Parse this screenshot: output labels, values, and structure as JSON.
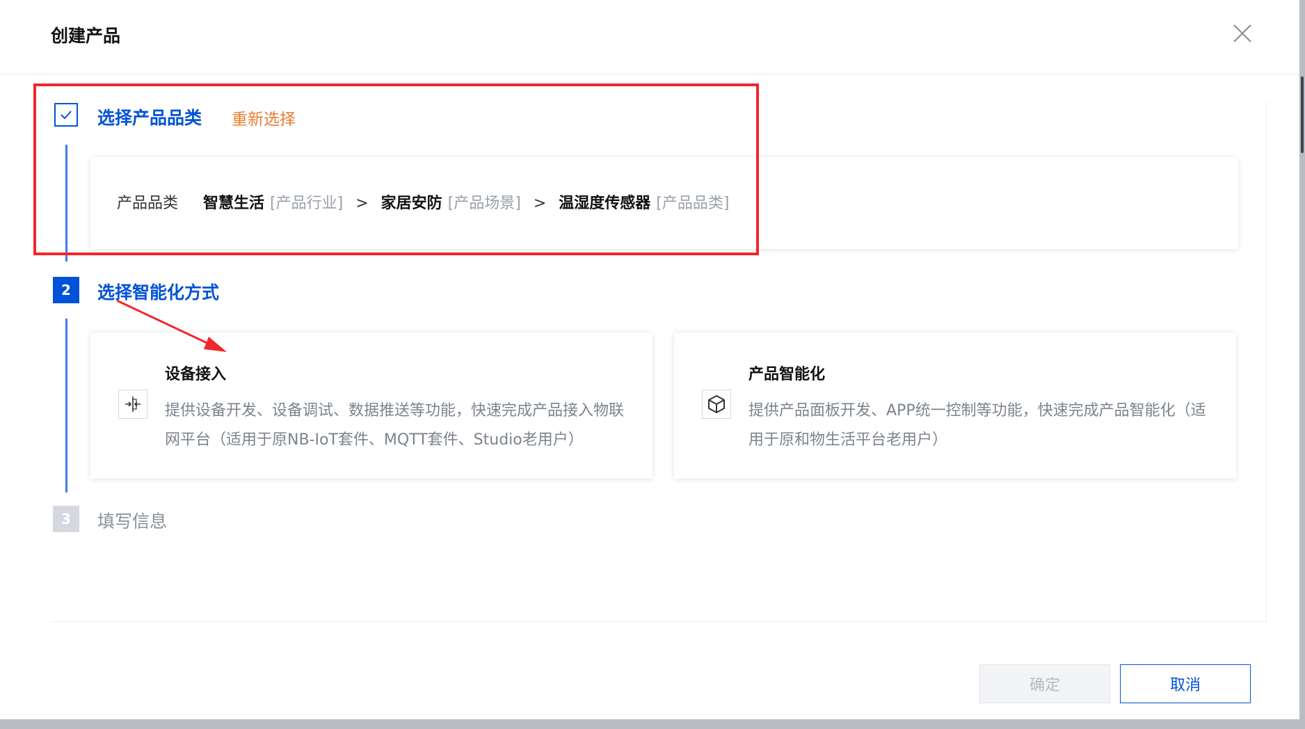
{
  "dialog": {
    "title": "创建产品"
  },
  "steps": {
    "step1": {
      "title": "选择产品品类",
      "action": "重新选择"
    },
    "step2": {
      "number": "2",
      "title": "选择智能化方式"
    },
    "step3": {
      "number": "3",
      "title": "填写信息"
    }
  },
  "category": {
    "label": "产品品类",
    "path": [
      {
        "name": "智慧生活",
        "tag": "[产品行业]"
      },
      {
        "name": "家居安防",
        "tag": "[产品场景]"
      },
      {
        "name": "温湿度传感器",
        "tag": "[产品品类]"
      }
    ],
    "separator": ">"
  },
  "options": [
    {
      "title": "设备接入",
      "description": "提供设备开发、设备调试、数据推送等功能，快速完成产品接入物联网平台（适用于原NB-IoT套件、MQTT套件、Studio老用户）",
      "icon": "device-access-icon"
    },
    {
      "title": "产品智能化",
      "description": "提供产品面板开发、APP统一控制等功能，快速完成产品智能化（适用于原和物生活平台老用户）",
      "icon": "cube-icon"
    }
  ],
  "footer": {
    "confirm_label": "确定",
    "cancel_label": "取消"
  },
  "colors": {
    "primary": "#0052d9",
    "accent_orange": "#ed7b2f",
    "annotation_red": "#f2262b"
  }
}
